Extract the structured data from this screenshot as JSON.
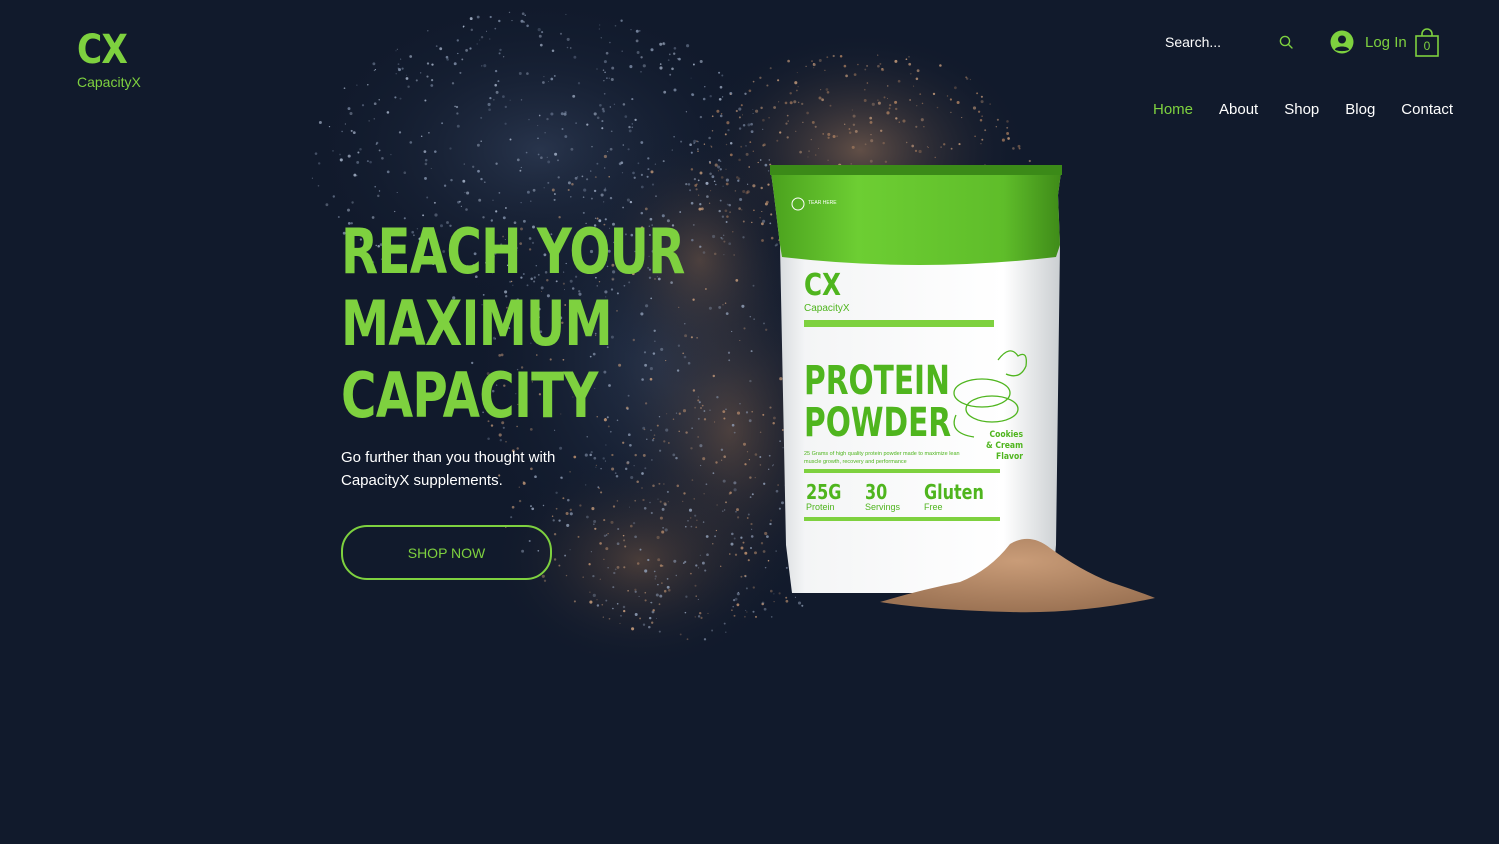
{
  "brand": {
    "mark": "CX",
    "name": "CapacityX"
  },
  "header": {
    "search_placeholder": "Search...",
    "login_label": "Log In",
    "cart_count": "0"
  },
  "nav": {
    "items": [
      {
        "label": "Home",
        "active": true
      },
      {
        "label": "About",
        "active": false
      },
      {
        "label": "Shop",
        "active": false
      },
      {
        "label": "Blog",
        "active": false
      },
      {
        "label": "Contact",
        "active": false
      }
    ]
  },
  "hero": {
    "title_lines": [
      "REACH YOUR",
      "MAXIMUM",
      "CAPACITY"
    ],
    "subtitle_lines": [
      "Go further than you thought with",
      "CapacityX supplements."
    ],
    "cta_label": "SHOP NOW"
  },
  "product": {
    "tear_label": "TEAR HERE",
    "brand_mark": "CX",
    "brand_name": "CapacityX",
    "title_lines": [
      "PROTEIN",
      "POWDER"
    ],
    "flavor_lines": [
      "Cookies",
      "& Cream",
      "Flavor"
    ],
    "description": "25 Grams of high quality protein powder made to maximize lean muscle growth, recovery and performance",
    "stats": [
      {
        "big": "25G",
        "small": "Protein"
      },
      {
        "big": "30",
        "small": "Servings"
      },
      {
        "big": "Gluten",
        "small": "Free"
      }
    ]
  },
  "colors": {
    "background": "#111a2c",
    "accent": "#7ed13f",
    "text": "#ffffff"
  }
}
